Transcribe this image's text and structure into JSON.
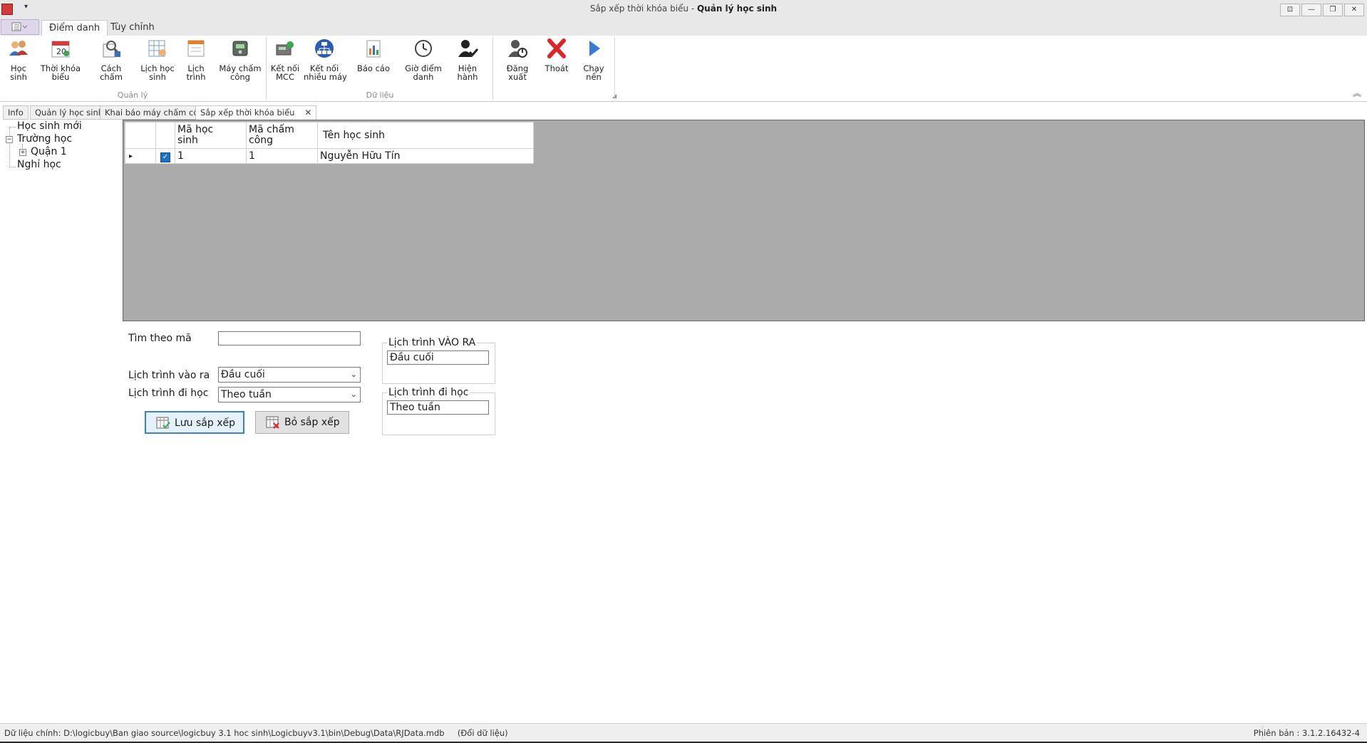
{
  "window": {
    "title_prefix": "Sắp xếp thời khóa biểu - ",
    "title_app": "Quản lý học sinh",
    "qat_arrow": "▾",
    "buttons": {
      "restore_ribbon": "⊡",
      "minimize": "—",
      "maximize": "❐",
      "close": "✕"
    }
  },
  "ribbon_tabs": [
    {
      "label": "Điểm danh",
      "active": true
    },
    {
      "label": "Tùy chỉnh",
      "active": false
    }
  ],
  "ribbon": {
    "groups": [
      {
        "label": "Quản lý"
      },
      {
        "label": "Dữ liệu"
      }
    ],
    "buttons": [
      {
        "label": "Học sinh",
        "icon": "students-icon"
      },
      {
        "label": "Thời khóa\nbiểu",
        "icon": "calendar-icon"
      },
      {
        "label": "Cách chấm",
        "icon": "inspect-icon"
      },
      {
        "label": "Lịch học\nsinh",
        "icon": "schedule-grid-icon"
      },
      {
        "label": "Lịch trình",
        "icon": "itinerary-icon"
      },
      {
        "label": "Máy chấm\ncông",
        "icon": "time-clock-icon"
      },
      {
        "label": "Kết nối\nMCC",
        "icon": "connect-icon"
      },
      {
        "label": "Kết nối\nnhiều máy",
        "icon": "network-icon"
      },
      {
        "label": "Báo cáo",
        "icon": "report-icon"
      },
      {
        "label": "Giờ điểm\ndanh",
        "icon": "clock-icon"
      },
      {
        "label": "Hiện hành",
        "icon": "user-check-icon"
      },
      {
        "label": "Đăng xuất",
        "icon": "logout-icon"
      },
      {
        "label": "Thoát",
        "icon": "exit-x-icon"
      },
      {
        "label": "Chạy nền",
        "icon": "play-icon"
      }
    ],
    "collapse_glyph": "︽",
    "launcher_glyph": "◢"
  },
  "doc_tabs": [
    {
      "label": "Info",
      "active": false
    },
    {
      "label": "Quản lý học sinh",
      "active": false
    },
    {
      "label": "Khai báo máy chấm công",
      "active": false
    },
    {
      "label": "Sắp xếp thời khóa biểu",
      "active": true,
      "close": "✕"
    }
  ],
  "tree": {
    "items": [
      {
        "label": "Học sinh mới"
      },
      {
        "label": "Trường học",
        "expander": "−"
      },
      {
        "label": "Quận 1",
        "expander": "+"
      },
      {
        "label": "Nghỉ học"
      }
    ]
  },
  "grid": {
    "columns": [
      "Mã học\nsinh",
      "Mã chấm\ncông",
      "Tên học sinh"
    ],
    "rows": [
      {
        "checked": true,
        "ma_hoc_sinh": "1",
        "ma_cham_cong": "1",
        "ten_hoc_sinh": "Nguyễn Hữu Tín"
      }
    ],
    "row_indicator": "▸",
    "check_glyph": "✓"
  },
  "form": {
    "search_label": "Tìm theo mã",
    "search_value": "",
    "vao_ra_label": "Lịch trình vào ra",
    "vao_ra_value": "Đầu cuối",
    "di_hoc_label": "Lịch trình đi học",
    "di_hoc_value": "Theo tuần",
    "combo_arrow": "⌄",
    "save_button": "Lưu sắp xếp",
    "remove_button": "Bỏ sắp xếp"
  },
  "groupboxes": {
    "vao_ra": {
      "title": "Lịch trình VÀO RA",
      "value": "Đầu cuối"
    },
    "di_hoc": {
      "title": "Lịch trình đi học",
      "value": "Theo tuần"
    }
  },
  "status": {
    "left": "Dữ liệu chính: D:\\logicbuy\\Ban giao source\\logicbuy 3.1 hoc sinh\\Logicbuyv3.1\\bin\\Debug\\Data\\RJData.mdb     (Đổi dữ liệu)",
    "right": "Phiên bản : 3.1.2.16432-4"
  },
  "colors": {
    "accent_blue": "#1f6fc6",
    "exit_red": "#d9262c",
    "grid_background": "#ababab"
  }
}
